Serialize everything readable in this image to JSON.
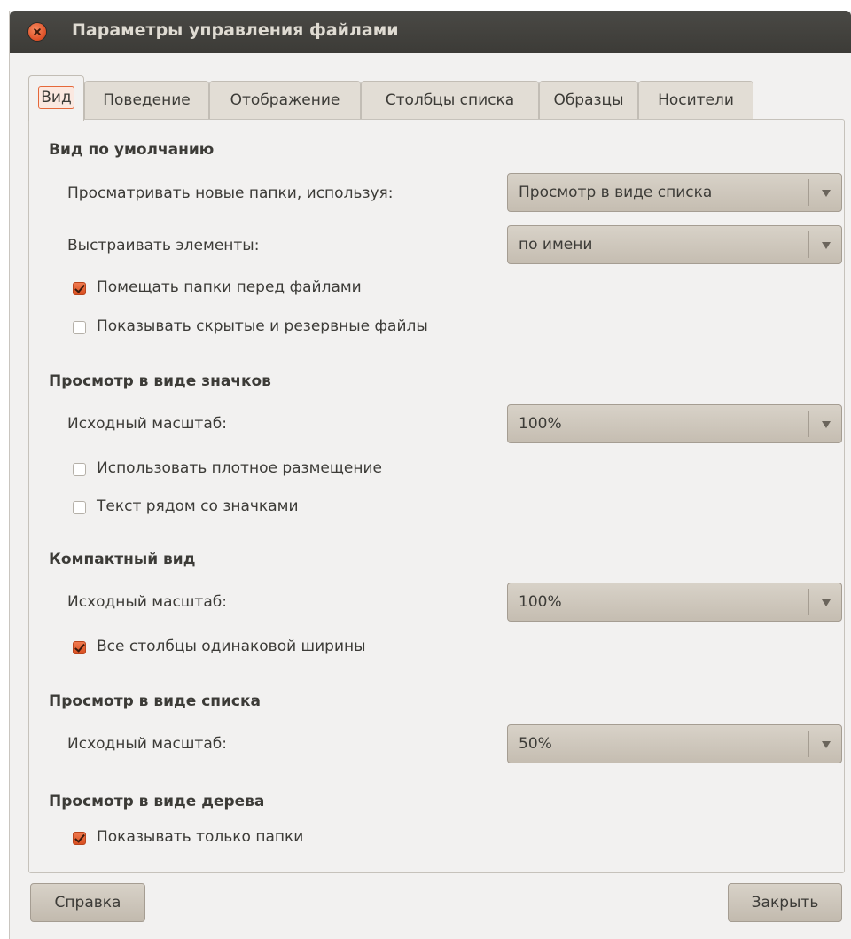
{
  "window": {
    "title": "Параметры управления файлами"
  },
  "tabs": [
    {
      "label": "Вид",
      "active": true
    },
    {
      "label": "Поведение",
      "active": false
    },
    {
      "label": "Отображение",
      "active": false
    },
    {
      "label": "Столбцы списка",
      "active": false
    },
    {
      "label": "Образцы",
      "active": false
    },
    {
      "label": "Носители",
      "active": false
    }
  ],
  "default_view": {
    "title": "Вид по умолчанию",
    "new_folders_label": "Просматривать новые папки, используя:",
    "new_folders_value": "Просмотр в виде списка",
    "arrange_label": "Выстраивать элементы:",
    "arrange_value": "по имени",
    "folders_first": {
      "label": "Помещать папки перед файлами",
      "checked": true
    },
    "show_hidden": {
      "label": "Показывать скрытые и резервные файлы",
      "checked": false
    }
  },
  "icon_view": {
    "title": "Просмотр в виде значков",
    "zoom_label": "Исходный масштаб:",
    "zoom_value": "100%",
    "compact_layout": {
      "label": "Использовать плотное размещение",
      "checked": false
    },
    "text_beside": {
      "label": "Текст рядом со значками",
      "checked": false
    }
  },
  "compact_view": {
    "title": "Компактный вид",
    "zoom_label": "Исходный масштаб:",
    "zoom_value": "100%",
    "same_width": {
      "label": "Все столбцы одинаковой ширины",
      "checked": true
    }
  },
  "list_view": {
    "title": "Просмотр в виде списка",
    "zoom_label": "Исходный масштаб:",
    "zoom_value": "50%"
  },
  "tree_view": {
    "title": "Просмотр в виде дерева",
    "only_folders": {
      "label": "Показывать только папки",
      "checked": true
    }
  },
  "buttons": {
    "help": "Справка",
    "close": "Закрыть"
  },
  "colors": {
    "accent": "#e05a2b",
    "titlebar": "#3c3b37",
    "window_bg": "#f2f1f0",
    "widget_bg": "#cfc8bd"
  }
}
